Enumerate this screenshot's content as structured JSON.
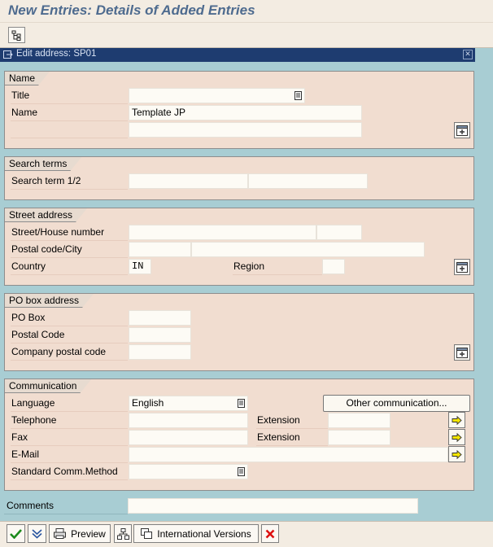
{
  "title": "New Entries: Details of Added Entries",
  "dialog": {
    "title": "Edit address:  SP01"
  },
  "groups": {
    "name": {
      "title": "Name",
      "labels": {
        "title": "Title",
        "name": "Name"
      },
      "values": {
        "title": "",
        "name": "Template JP",
        "name2": ""
      }
    },
    "search_terms": {
      "title": "Search terms",
      "labels": {
        "search_term": "Search term 1/2"
      },
      "values": {
        "term1": "",
        "term2": ""
      }
    },
    "street_address": {
      "title": "Street address",
      "labels": {
        "street": "Street/House number",
        "postal_city": "Postal code/City",
        "country": "Country",
        "region": "Region"
      },
      "values": {
        "street": "",
        "house_number": "",
        "postal_code": "",
        "city": "",
        "country": "IN",
        "region": ""
      }
    },
    "po_box": {
      "title": "PO box address",
      "labels": {
        "po_box": "PO Box",
        "postal_code": "Postal Code",
        "company_postal_code": "Company postal code"
      },
      "values": {
        "po_box": "",
        "postal_code": "",
        "company_postal_code": ""
      }
    },
    "communication": {
      "title": "Communication",
      "labels": {
        "language": "Language",
        "telephone": "Telephone",
        "fax": "Fax",
        "email": "E-Mail",
        "std_comm": "Standard Comm.Method",
        "extension": "Extension"
      },
      "values": {
        "language": "English",
        "telephone": "",
        "telephone_ext": "",
        "fax": "",
        "fax_ext": "",
        "email": "",
        "std_comm": ""
      },
      "other_button": "Other communication..."
    }
  },
  "comments": {
    "label": "Comments",
    "value": ""
  },
  "bottom_toolbar": {
    "preview": "Preview",
    "international": "International Versions"
  },
  "colors": {
    "group_bg": "#f1ddd0",
    "dialog_bg": "#a8cdd3",
    "header_bg": "#1e3c70",
    "title_color": "#4e6b8f"
  }
}
